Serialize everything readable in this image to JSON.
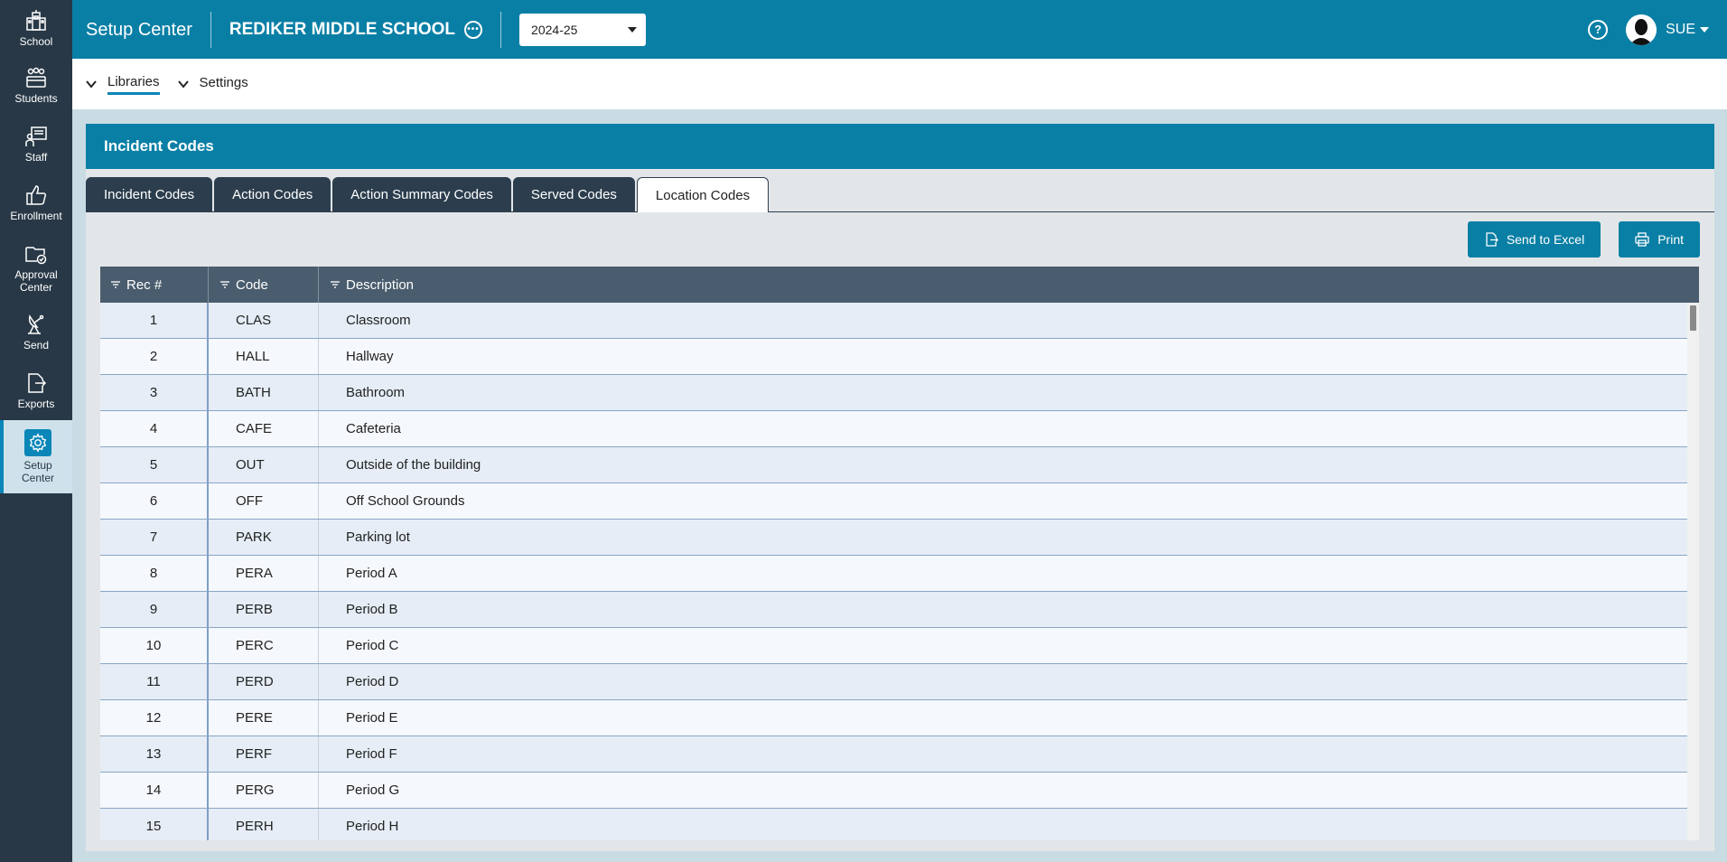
{
  "sidebar": {
    "items": [
      {
        "label": "School",
        "icon": "school-icon"
      },
      {
        "label": "Students",
        "icon": "students-icon"
      },
      {
        "label": "Staff",
        "icon": "staff-icon"
      },
      {
        "label": "Enrollment",
        "icon": "thumbs-up-icon"
      },
      {
        "label": "Approval Center",
        "icon": "folder-check-icon"
      },
      {
        "label": "Send",
        "icon": "satellite-icon"
      },
      {
        "label": "Exports",
        "icon": "export-icon"
      },
      {
        "label": "Setup Center",
        "icon": "gear-icon",
        "active": true
      }
    ]
  },
  "header": {
    "app_title": "Setup Center",
    "school_name": "REDIKER MIDDLE SCHOOL",
    "year": "2024-25",
    "user": "SUE"
  },
  "subnav": {
    "items": [
      "Libraries",
      "Settings"
    ],
    "active": "Libraries"
  },
  "panel": {
    "title": "Incident Codes",
    "tabs": [
      "Incident Codes",
      "Action Codes",
      "Action Summary Codes",
      "Served Codes",
      "Location Codes"
    ],
    "active_tab": "Location Codes",
    "buttons": {
      "excel": "Send to Excel",
      "print": "Print"
    }
  },
  "grid": {
    "columns": [
      "Rec #",
      "Code",
      "Description"
    ],
    "rows": [
      {
        "rec": "1",
        "code": "CLAS",
        "desc": "Classroom"
      },
      {
        "rec": "2",
        "code": "HALL",
        "desc": "Hallway"
      },
      {
        "rec": "3",
        "code": "BATH",
        "desc": "Bathroom"
      },
      {
        "rec": "4",
        "code": "CAFE",
        "desc": "Cafeteria"
      },
      {
        "rec": "5",
        "code": "OUT",
        "desc": "Outside of the building"
      },
      {
        "rec": "6",
        "code": "OFF",
        "desc": "Off School Grounds"
      },
      {
        "rec": "7",
        "code": "PARK",
        "desc": "Parking lot"
      },
      {
        "rec": "8",
        "code": "PERA",
        "desc": "Period A"
      },
      {
        "rec": "9",
        "code": "PERB",
        "desc": "Period B"
      },
      {
        "rec": "10",
        "code": "PERC",
        "desc": "Period C"
      },
      {
        "rec": "11",
        "code": "PERD",
        "desc": "Period D"
      },
      {
        "rec": "12",
        "code": "PERE",
        "desc": "Period E"
      },
      {
        "rec": "13",
        "code": "PERF",
        "desc": "Period F"
      },
      {
        "rec": "14",
        "code": "PERG",
        "desc": "Period G"
      },
      {
        "rec": "15",
        "code": "PERH",
        "desc": "Period H"
      }
    ]
  },
  "colors": {
    "sidebar_bg": "#283846",
    "header_bg": "#0a7fa5",
    "tab_bg": "#2c3e4e",
    "grid_head_bg": "#4a5d6e",
    "accent": "#0a86b8"
  }
}
